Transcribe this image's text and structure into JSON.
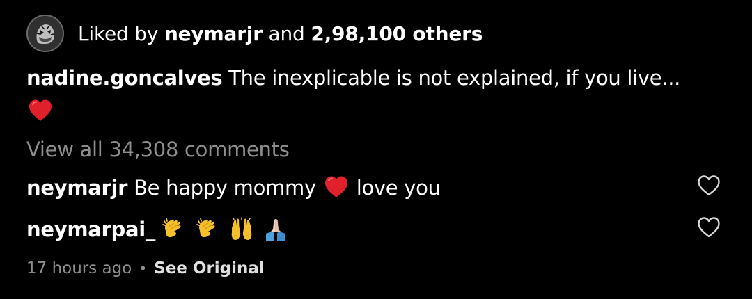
{
  "likes": {
    "prefix": "Liked by ",
    "user": "neymarjr",
    "connector": " and ",
    "count": "2,98,100 others"
  },
  "caption": {
    "username": "nadine.goncalves",
    "text": "The inexplicable is not explained, if you live...",
    "emoji": "red-heart"
  },
  "view_all": "View all 34,308 comments",
  "comments": [
    {
      "username": "neymarjr",
      "text_before": "Be happy mommy",
      "emoji": "red-heart",
      "text_after": "love you"
    },
    {
      "username": "neymarpai_",
      "emojis": [
        "clapping-hands",
        "clapping-hands",
        "raising-hands",
        "folded-hands"
      ]
    }
  ],
  "meta": {
    "time": "17 hours ago",
    "separator": "•",
    "see_original": "See Original"
  },
  "colors": {
    "background": "#000000",
    "text": "#ffffff",
    "secondary": "#8e8e8e",
    "heart": "#e0212b"
  }
}
